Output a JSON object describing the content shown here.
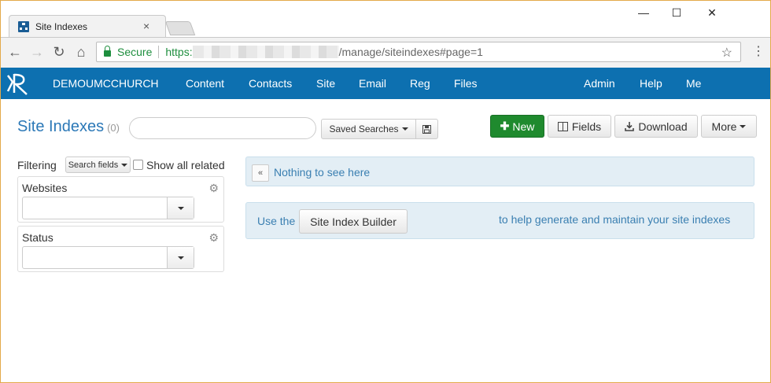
{
  "browser": {
    "tab_title": "Site Indexes",
    "tab_close": "×",
    "window_controls": {
      "minimize": "—",
      "maximize": "☐",
      "close": "✕"
    },
    "url": {
      "secure_label": "Secure",
      "scheme": "https:",
      "path": "/manage/siteindexes#page=1"
    }
  },
  "navbar": {
    "org": "DEMOUMCCHURCH",
    "items_left": [
      "Content",
      "Contacts",
      "Site",
      "Email",
      "Reg",
      "Files"
    ],
    "items_right": [
      "Admin",
      "Help",
      "Me"
    ],
    "color": "#0d70b0"
  },
  "page": {
    "title": "Site Indexes",
    "count": "(0)",
    "search_placeholder": "",
    "saved_searches_label": "Saved Searches",
    "actions": {
      "new_label": "New",
      "fields_label": "Fields",
      "download_label": "Download",
      "more_label": "More"
    }
  },
  "filters": {
    "filtering_label": "Filtering",
    "search_fields_label": "Search fields",
    "show_all_related_label": "Show all related",
    "panels": [
      {
        "label": "Websites",
        "value": ""
      },
      {
        "label": "Status",
        "value": ""
      }
    ]
  },
  "content": {
    "empty_message": "Nothing to see here",
    "builder_prefix": "Use the",
    "builder_button": "Site Index Builder",
    "builder_suffix": "to help generate and maintain your site indexes"
  }
}
